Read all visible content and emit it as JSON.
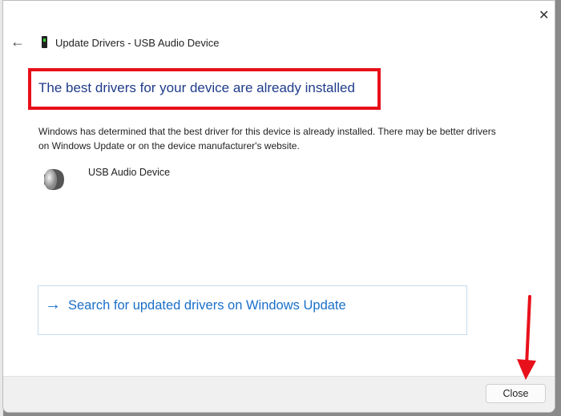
{
  "window": {
    "title": "Update Drivers - USB Audio Device"
  },
  "main": {
    "heading": "The best drivers for your device are already installed",
    "description": "Windows has determined that the best driver for this device is already installed. There may be better drivers on Windows Update or on the device manufacturer's website.",
    "device_name": "USB Audio Device",
    "search_link": "Search for updated drivers on Windows Update"
  },
  "footer": {
    "close_label": "Close"
  },
  "colors": {
    "highlight": "#e8101a",
    "heading": "#1f3c8a",
    "link": "#1a6fc9"
  }
}
